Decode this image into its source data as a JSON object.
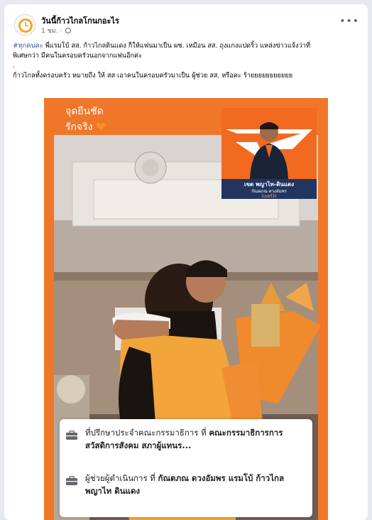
{
  "header": {
    "page_name": "วันนี้ก้าวไกลโกนกอะไร",
    "time": "1 ชม.",
    "more_label": "•••"
  },
  "caption": {
    "hashtag": "#ทุกคนคะ",
    "line1": " พี่แรมโบ้ สส. ก้าวไกลดินแดง ก็ให้แฟนมาเป็น ผช. เหมือน สส. ถุงแกงแปดริ้ว แหล่งข่าวแจ้งว่าที่",
    "line2": "พิเศษกว่า มีคนในครอบครัวนอกจากแฟนอีกค่ะ",
    "dot": ".",
    "line3": "ก้าวไกลทั้งครอบครัว หมายถึง ให้ สส เอาคนในครอบครัวมาเป็น ผู้ช่วย สส. หรือคะ ร้ายยยยยยยยยยย"
  },
  "photo": {
    "text_line1": "จุดยืนชัด",
    "text_line2": "รักจริง",
    "inset_name": "เขต พญาไท-ดินแดง",
    "inset_person": "กัณตภณ ดวงอัมพร",
    "inset_number": "(เบอร์3)"
  },
  "info_box": {
    "row1_prefix": "ที่ปรึกษาประจำคณะกรรมาธิการ ที่ ",
    "row1_bold": "คณะกรรมาธิการการสวัสดิการสังคม สภาผู้แทนร...",
    "row2_prefix": "ผู้ช่วยผู้ดำเนินการ ที่ ",
    "row2_bold": "กัณตภณ ดวงอัมพร แรมโบ้ ก้าวไกล พญาไท ดินแดง"
  },
  "colors": {
    "party_orange": "#f26a1f",
    "navy": "#21355f",
    "link_blue": "#385898"
  }
}
